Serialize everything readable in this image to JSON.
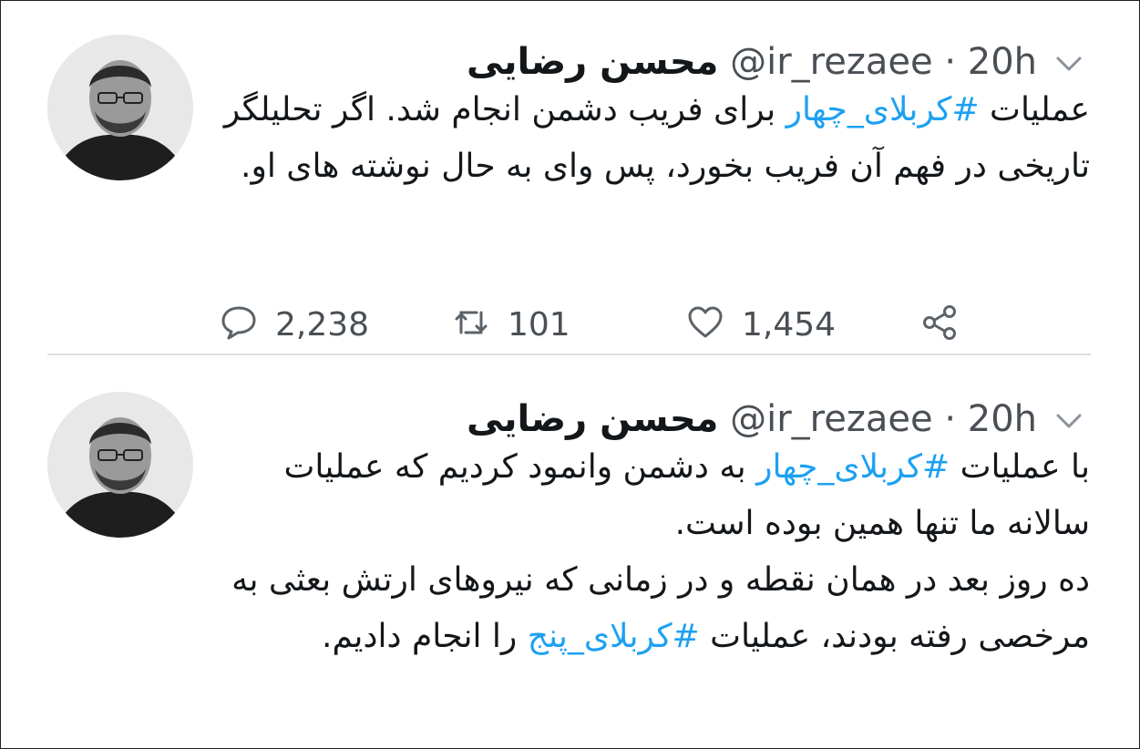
{
  "tweets": [
    {
      "author_name": "محسن رضایی",
      "handle": "@ir_rezaee",
      "separator": "·",
      "time": "20h",
      "paragraphs": [
        [
          {
            "text": "عملیات ",
            "tag": false
          },
          {
            "text": "#کربلای_چهار",
            "tag": true
          },
          {
            "text": " برای فریب دشمن انجام شد. اگر تحلیلگر تاریخی  در فهم آن فریب بخورد، پس وای به حال نوشته های او.",
            "tag": false
          }
        ]
      ],
      "replies": "2,238",
      "retweets": "101",
      "likes": "1,454"
    },
    {
      "author_name": "محسن رضایی",
      "handle": "@ir_rezaee",
      "separator": "·",
      "time": "20h",
      "paragraphs": [
        [
          {
            "text": "با عملیات ",
            "tag": false
          },
          {
            "text": "#کربلای_چهار",
            "tag": true
          },
          {
            "text": " به دشمن وانمود کردیم که عملیات سالانه ما تنها همین بوده است.",
            "tag": false
          }
        ],
        [
          {
            "text": "ده روز بعد در همان نقطه و در زمانی که نیروهای ارتش بعثی به مرخصی رفته بودند، عملیات ",
            "tag": false
          },
          {
            "text": "#کربلای_پنج",
            "tag": true
          },
          {
            "text": " را انجام دادیم.",
            "tag": false
          }
        ]
      ]
    }
  ],
  "colors": {
    "hashtag": "#1da1f2",
    "meta": "#4a4f55",
    "divider": "#dcdfe2"
  },
  "icons": [
    "chevron-down-icon",
    "reply-icon",
    "retweet-icon",
    "like-icon",
    "share-icon"
  ]
}
